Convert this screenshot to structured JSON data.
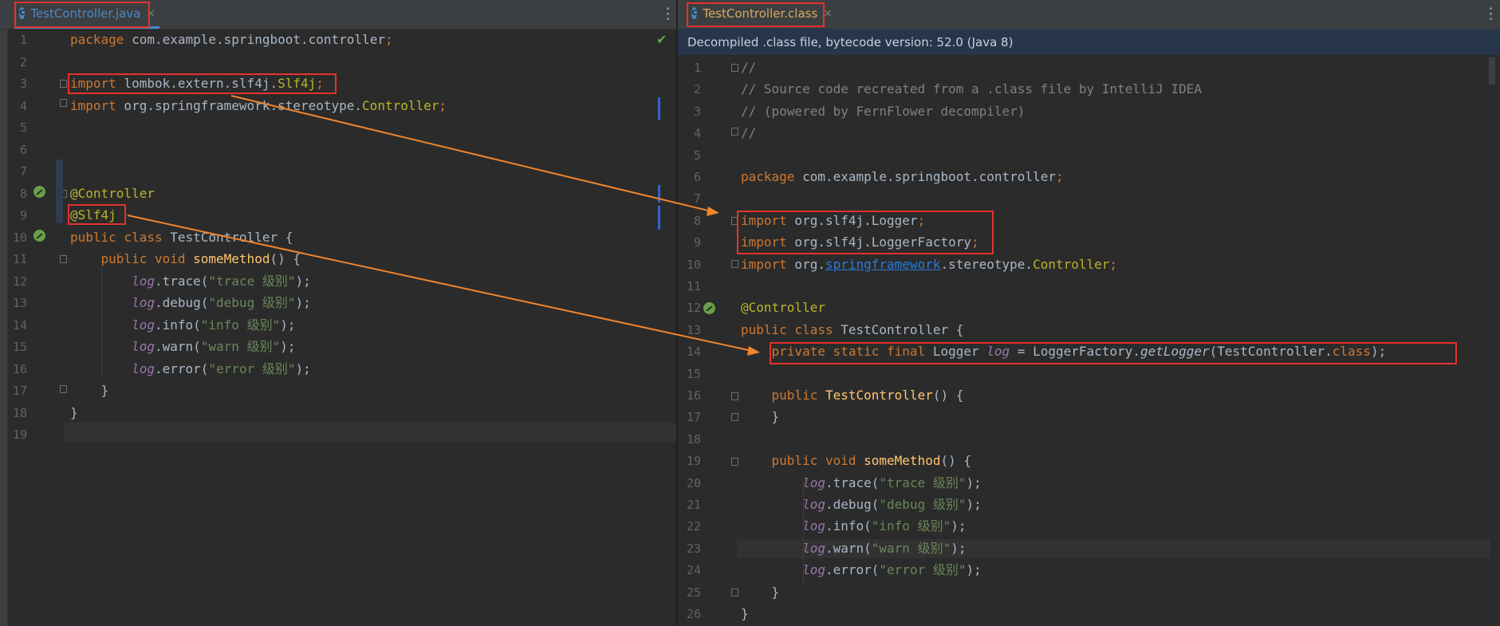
{
  "left_tab": {
    "icon": "C",
    "label": "TestController.java",
    "close": "×"
  },
  "right_tab": {
    "icon": "C",
    "label": "TestController.class",
    "close": "×"
  },
  "more_options": "⋮",
  "right_banner": "Decompiled .class file, bytecode version: 52.0 (Java 8)",
  "left_status": "✔",
  "left_editor": {
    "line_numbers": [
      "1",
      "2",
      "3",
      "4",
      "5",
      "6",
      "7",
      "8",
      "9",
      "10",
      "11",
      "12",
      "13",
      "14",
      "15",
      "16",
      "17",
      "18",
      "19"
    ],
    "lines": [
      [
        {
          "t": "package",
          "c": "kw"
        },
        {
          "t": " com.example.springboot.controller",
          "c": ""
        },
        {
          "t": ";",
          "c": "kw"
        }
      ],
      [],
      [
        {
          "t": "import",
          "c": "kw"
        },
        {
          "t": " lombok.extern.slf4j.",
          "c": ""
        },
        {
          "t": "Slf4j",
          "c": "ann"
        },
        {
          "t": ";",
          "c": "kw"
        }
      ],
      [
        {
          "t": "import",
          "c": "kw"
        },
        {
          "t": " org.springframework.stereotype.",
          "c": ""
        },
        {
          "t": "Controller",
          "c": "ann"
        },
        {
          "t": ";",
          "c": "kw"
        }
      ],
      [],
      [],
      [],
      [
        {
          "t": "@Controller",
          "c": "ann"
        }
      ],
      [
        {
          "t": "@Slf4j",
          "c": "ann"
        }
      ],
      [
        {
          "t": "public class",
          "c": "kw"
        },
        {
          "t": " TestController {",
          "c": ""
        }
      ],
      [
        {
          "t": "    public void ",
          "c": "kw"
        },
        {
          "t": "someMethod",
          "c": "fn"
        },
        {
          "t": "() {",
          "c": ""
        }
      ],
      [
        {
          "t": "        ",
          "c": ""
        },
        {
          "t": "log",
          "c": "fld"
        },
        {
          "t": ".trace(",
          "c": ""
        },
        {
          "t": "\"trace 级别\"",
          "c": "str"
        },
        {
          "t": ");",
          "c": ""
        }
      ],
      [
        {
          "t": "        ",
          "c": ""
        },
        {
          "t": "log",
          "c": "fld"
        },
        {
          "t": ".debug(",
          "c": ""
        },
        {
          "t": "\"debug 级别\"",
          "c": "str"
        },
        {
          "t": ");",
          "c": ""
        }
      ],
      [
        {
          "t": "        ",
          "c": ""
        },
        {
          "t": "log",
          "c": "fld"
        },
        {
          "t": ".info(",
          "c": ""
        },
        {
          "t": "\"info 级别\"",
          "c": "str"
        },
        {
          "t": ");",
          "c": ""
        }
      ],
      [
        {
          "t": "        ",
          "c": ""
        },
        {
          "t": "log",
          "c": "fld"
        },
        {
          "t": ".warn(",
          "c": ""
        },
        {
          "t": "\"warn 级别\"",
          "c": "str"
        },
        {
          "t": ");",
          "c": ""
        }
      ],
      [
        {
          "t": "        ",
          "c": ""
        },
        {
          "t": "log",
          "c": "fld"
        },
        {
          "t": ".error(",
          "c": ""
        },
        {
          "t": "\"error 级别\"",
          "c": "str"
        },
        {
          "t": ");",
          "c": ""
        }
      ],
      [
        {
          "t": "    }",
          "c": ""
        }
      ],
      [
        {
          "t": "}",
          "c": ""
        }
      ],
      []
    ]
  },
  "right_editor": {
    "line_numbers": [
      "1",
      "2",
      "3",
      "4",
      "5",
      "6",
      "7",
      "8",
      "9",
      "10",
      "11",
      "12",
      "13",
      "14",
      "15",
      "16",
      "17",
      "18",
      "19",
      "20",
      "21",
      "22",
      "23",
      "24",
      "25",
      "26"
    ],
    "lines": [
      [
        {
          "t": "//",
          "c": "cm"
        }
      ],
      [
        {
          "t": "// Source code recreated from a .class file by IntelliJ IDEA",
          "c": "cm"
        }
      ],
      [
        {
          "t": "// (powered by FernFlower decompiler)",
          "c": "cm"
        }
      ],
      [
        {
          "t": "//",
          "c": "cm"
        }
      ],
      [],
      [
        {
          "t": "package",
          "c": "kw"
        },
        {
          "t": " com.example.springboot.controller",
          "c": ""
        },
        {
          "t": ";",
          "c": "kw"
        }
      ],
      [],
      [
        {
          "t": "import",
          "c": "kw"
        },
        {
          "t": " org.slf4j.Logger",
          "c": ""
        },
        {
          "t": ";",
          "c": "kw"
        }
      ],
      [
        {
          "t": "import",
          "c": "kw"
        },
        {
          "t": " org.slf4j.LoggerFactory",
          "c": ""
        },
        {
          "t": ";",
          "c": "kw"
        }
      ],
      [
        {
          "t": "import",
          "c": "kw"
        },
        {
          "t": " org.",
          "c": ""
        },
        {
          "t": "springframework",
          "c": "lnk"
        },
        {
          "t": ".stereotype.",
          "c": ""
        },
        {
          "t": "Controller",
          "c": "ann"
        },
        {
          "t": ";",
          "c": "kw"
        }
      ],
      [],
      [
        {
          "t": "@Controller",
          "c": "ann"
        }
      ],
      [
        {
          "t": "public class",
          "c": "kw"
        },
        {
          "t": " TestController {",
          "c": ""
        }
      ],
      [
        {
          "t": "    private static final ",
          "c": "kw"
        },
        {
          "t": "Logger ",
          "c": ""
        },
        {
          "t": "log",
          "c": "fld"
        },
        {
          "t": " = LoggerFactory.",
          "c": ""
        },
        {
          "t": "getLogger",
          "c": "mth"
        },
        {
          "t": "(TestController.",
          "c": ""
        },
        {
          "t": "class",
          "c": "kw"
        },
        {
          "t": ");",
          "c": ""
        }
      ],
      [],
      [
        {
          "t": "    public ",
          "c": "kw"
        },
        {
          "t": "TestController",
          "c": "fn"
        },
        {
          "t": "() {",
          "c": ""
        }
      ],
      [
        {
          "t": "    }",
          "c": ""
        }
      ],
      [],
      [
        {
          "t": "    public void ",
          "c": "kw"
        },
        {
          "t": "someMethod",
          "c": "fn"
        },
        {
          "t": "() {",
          "c": ""
        }
      ],
      [
        {
          "t": "        ",
          "c": ""
        },
        {
          "t": "log",
          "c": "fld"
        },
        {
          "t": ".trace(",
          "c": ""
        },
        {
          "t": "\"trace 级别\"",
          "c": "str"
        },
        {
          "t": ");",
          "c": ""
        }
      ],
      [
        {
          "t": "        ",
          "c": ""
        },
        {
          "t": "log",
          "c": "fld"
        },
        {
          "t": ".debug(",
          "c": ""
        },
        {
          "t": "\"debug 级别\"",
          "c": "str"
        },
        {
          "t": ");",
          "c": ""
        }
      ],
      [
        {
          "t": "        ",
          "c": ""
        },
        {
          "t": "log",
          "c": "fld"
        },
        {
          "t": ".info(",
          "c": ""
        },
        {
          "t": "\"info 级别\"",
          "c": "str"
        },
        {
          "t": ");",
          "c": ""
        }
      ],
      [
        {
          "t": "        ",
          "c": ""
        },
        {
          "t": "log",
          "c": "fld"
        },
        {
          "t": ".warn(",
          "c": ""
        },
        {
          "t": "\"warn 级别\"",
          "c": "str"
        },
        {
          "t": ");",
          "c": ""
        }
      ],
      [
        {
          "t": "        ",
          "c": ""
        },
        {
          "t": "log",
          "c": "fld"
        },
        {
          "t": ".error(",
          "c": ""
        },
        {
          "t": "\"error 级别\"",
          "c": "str"
        },
        {
          "t": ");",
          "c": ""
        }
      ],
      [
        {
          "t": "    }",
          "c": ""
        }
      ],
      [
        {
          "t": "}",
          "c": ""
        }
      ]
    ]
  },
  "colors": {
    "highlight_red": "#e4322b",
    "arrow_orange": "#f0852d",
    "tab_active_text": "#4a88c7",
    "tab_right_text": "#d7a95c"
  }
}
